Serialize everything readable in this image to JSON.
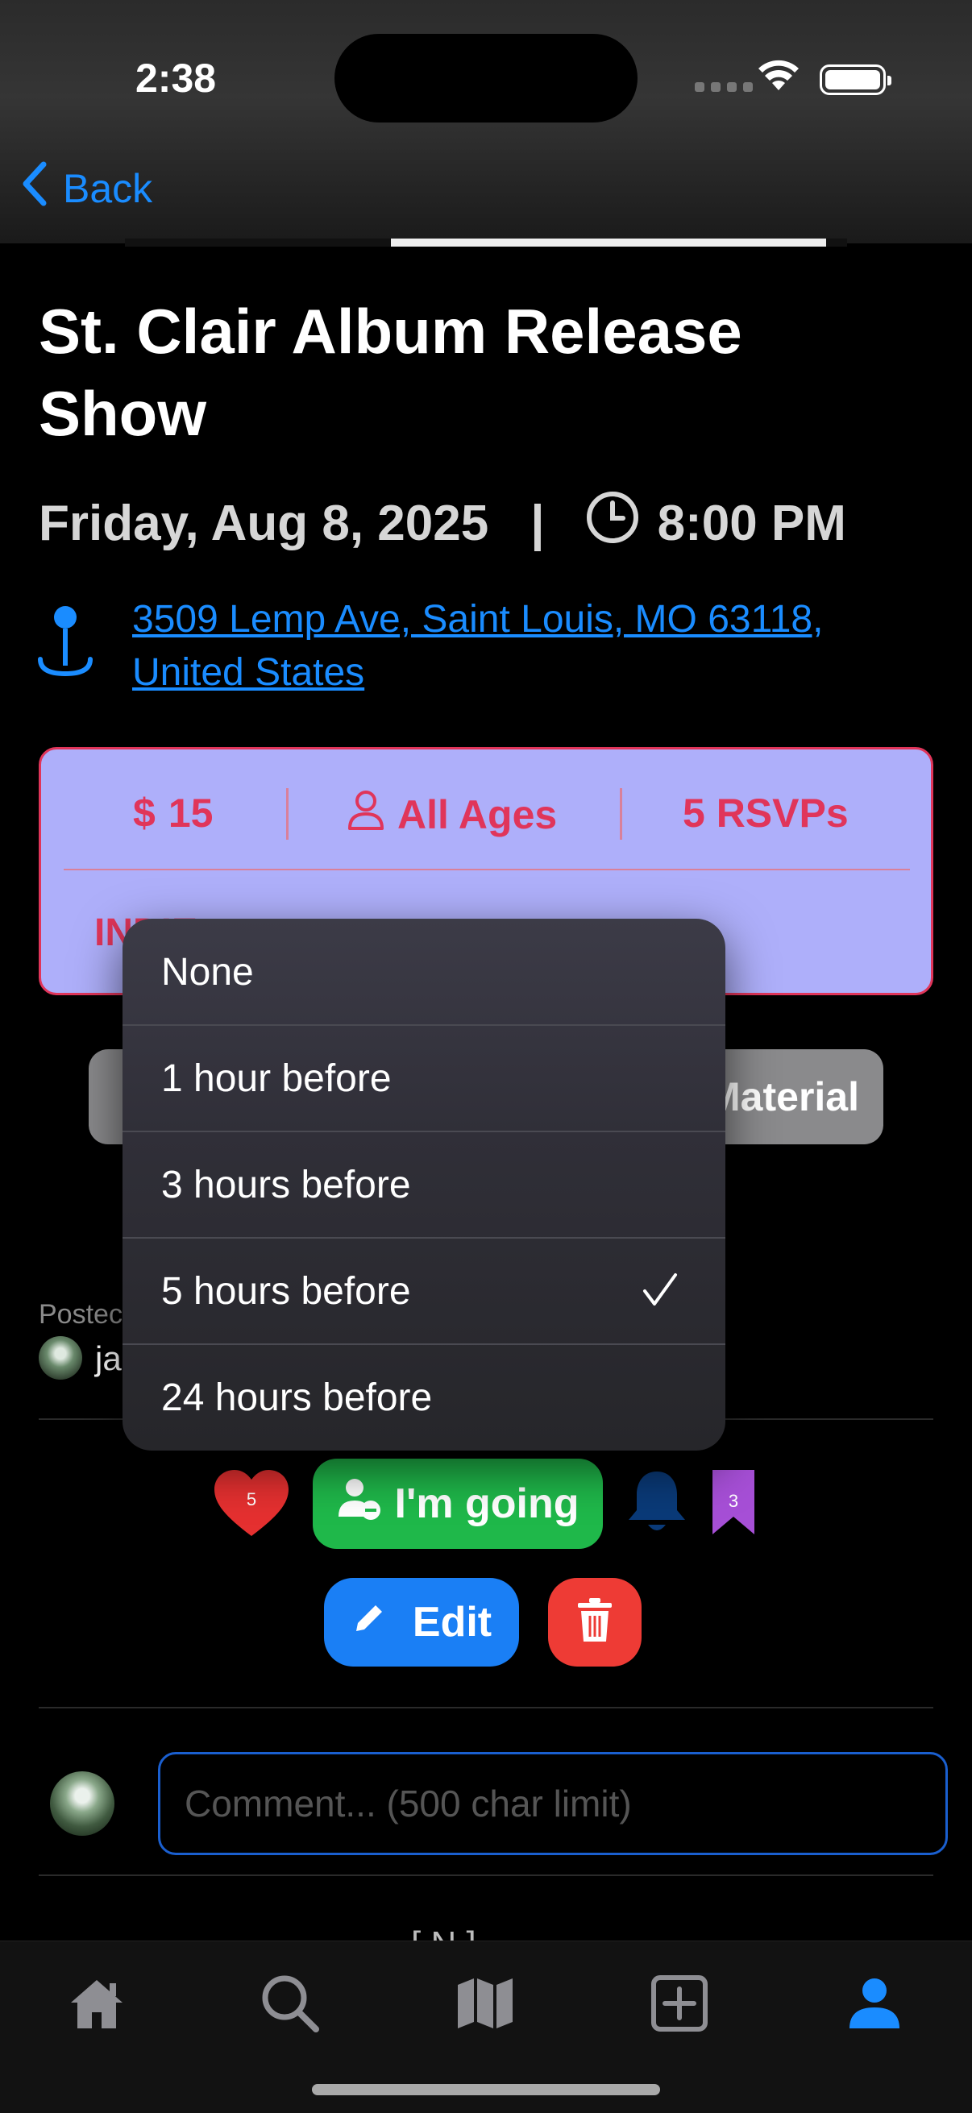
{
  "status_bar": {
    "time": "2:38"
  },
  "nav": {
    "back_label": "Back"
  },
  "event": {
    "title": "St. Clair Album Release Show",
    "date": "Friday, Aug 8, 2025",
    "separator": "|",
    "time": "8:00 PM",
    "address": "3509 Lemp Ave, Saint Louis, MO  63118, United States"
  },
  "info": {
    "price": "15",
    "age": "All Ages",
    "rsvps": "5 RSVPs",
    "genre_partial": "INDIE"
  },
  "buttons": {
    "right_pill_partial": "Material",
    "going_label": "I'm going",
    "edit_label": "Edit",
    "likes_count": "5",
    "bookmark_count": "3"
  },
  "poster": {
    "posted_partial": "Postec",
    "name_partial": "ja"
  },
  "comment": {
    "placeholder": "Comment... (500 char limit)",
    "below_partial": "[ N   ]"
  },
  "reminder_menu": {
    "options": [
      {
        "label": "None",
        "selected": false
      },
      {
        "label": "1 hour before",
        "selected": false
      },
      {
        "label": "3 hours before",
        "selected": false
      },
      {
        "label": "5 hours before",
        "selected": true
      },
      {
        "label": "24 hours before",
        "selected": false
      }
    ]
  },
  "tabbar": {
    "items": [
      {
        "icon": "home-icon",
        "active": false
      },
      {
        "icon": "search-icon",
        "active": false
      },
      {
        "icon": "map-icon",
        "active": false
      },
      {
        "icon": "add-square-icon",
        "active": false
      },
      {
        "icon": "profile-icon",
        "active": true
      }
    ]
  },
  "colors": {
    "accent_blue": "#1a8cff",
    "card_bg": "#aeaffa",
    "card_text": "#e0355a",
    "going_green": "#1fb84a",
    "edit_blue": "#1a7ff5",
    "delete_red": "#ee3b35",
    "bookmark_purple": "#a64fd6"
  }
}
